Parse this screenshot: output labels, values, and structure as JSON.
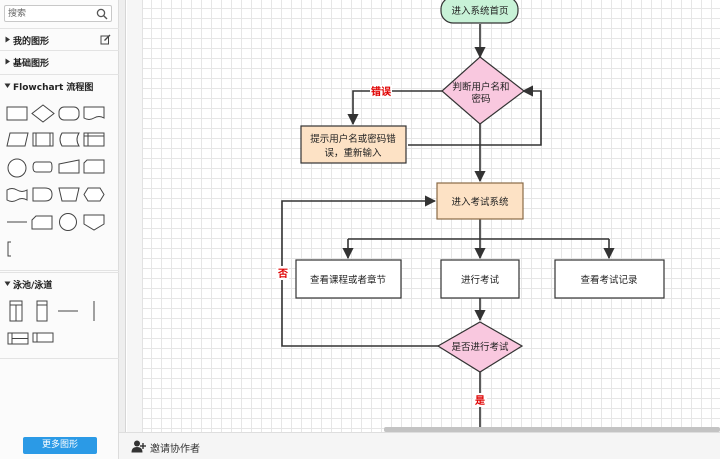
{
  "sidebar": {
    "search_placeholder": "搜索",
    "sections": {
      "my_shapes": "我的图形",
      "basic_shapes": "基础图形",
      "flowchart": "Flowchart 流程图",
      "swimlane": "泳池/泳道"
    },
    "more_shapes_button": "更多图形"
  },
  "bottombar": {
    "invite_label": "邀请协作者"
  },
  "flowchart": {
    "start": "进入系统首页",
    "check_login": [
      "判断用户名和",
      "密码"
    ],
    "error_prompt": [
      "提示用户名或密码错",
      "误，重新输入"
    ],
    "enter_exam_system": "进入考试系统",
    "view_courses": "查看课程或者章节",
    "take_exam": "进行考试",
    "view_records": "查看考试记录",
    "decide_exam": "是否进行考试",
    "label_error": "错误",
    "label_no": "否",
    "label_yes": "是"
  },
  "colors": {
    "start_fill": "#c8f2d7",
    "decision_fill": "#f9c8df",
    "process_orange_fill": "#fde2c5",
    "process_orange_stroke": "#8a6a45",
    "line": "#333333",
    "label_red": "#e00000",
    "primary_button": "#2b9ae6"
  }
}
